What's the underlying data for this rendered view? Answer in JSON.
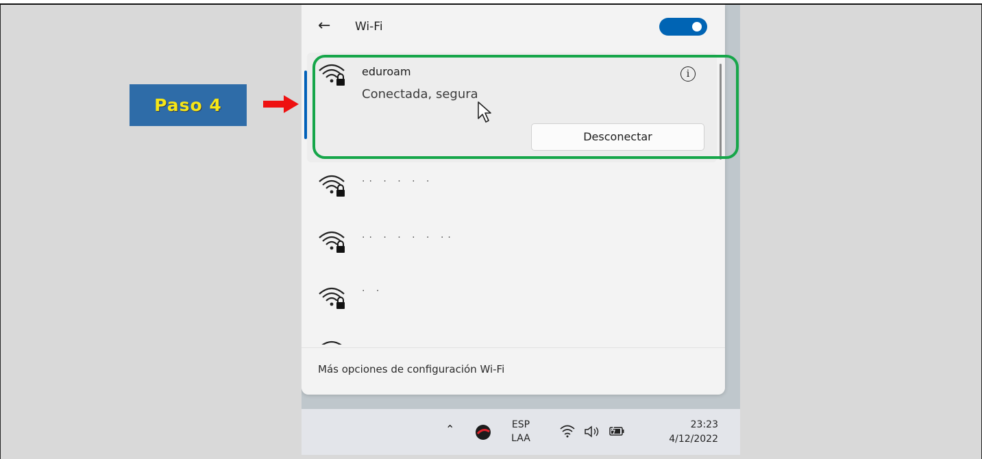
{
  "annotation": {
    "step_label": "Paso 4",
    "highlight_color": "#16a64a",
    "arrow_color": "#ee1111",
    "badge_bg": "#2e6ca8",
    "badge_text_color": "#f5e617"
  },
  "wifi_panel": {
    "title": "Wi-Fi",
    "toggle_on": true,
    "accent": "#0064b4",
    "networks": [
      {
        "name": "eduroam",
        "status": "Conectada, segura",
        "secured": true,
        "connected": true,
        "action_label": "Desconectar"
      },
      {
        "name": "··  ·  ·  ·  ·",
        "secured": true,
        "connected": false
      },
      {
        "name": "··  ·  ·  ·  ·  ··",
        "secured": true,
        "connected": false
      },
      {
        "name": "·  ·",
        "secured": true,
        "connected": false
      },
      {
        "name": "",
        "secured": false,
        "connected": false
      }
    ],
    "footer_link": "Más opciones de configuración Wi-Fi"
  },
  "taskbar": {
    "lang_top": "ESP",
    "lang_bottom": "LAA",
    "time": "23:23",
    "date": "4/12/2022",
    "icons": [
      "chevron-up-icon",
      "app-tray-icon",
      "wifi-icon",
      "volume-icon",
      "battery-icon"
    ]
  }
}
